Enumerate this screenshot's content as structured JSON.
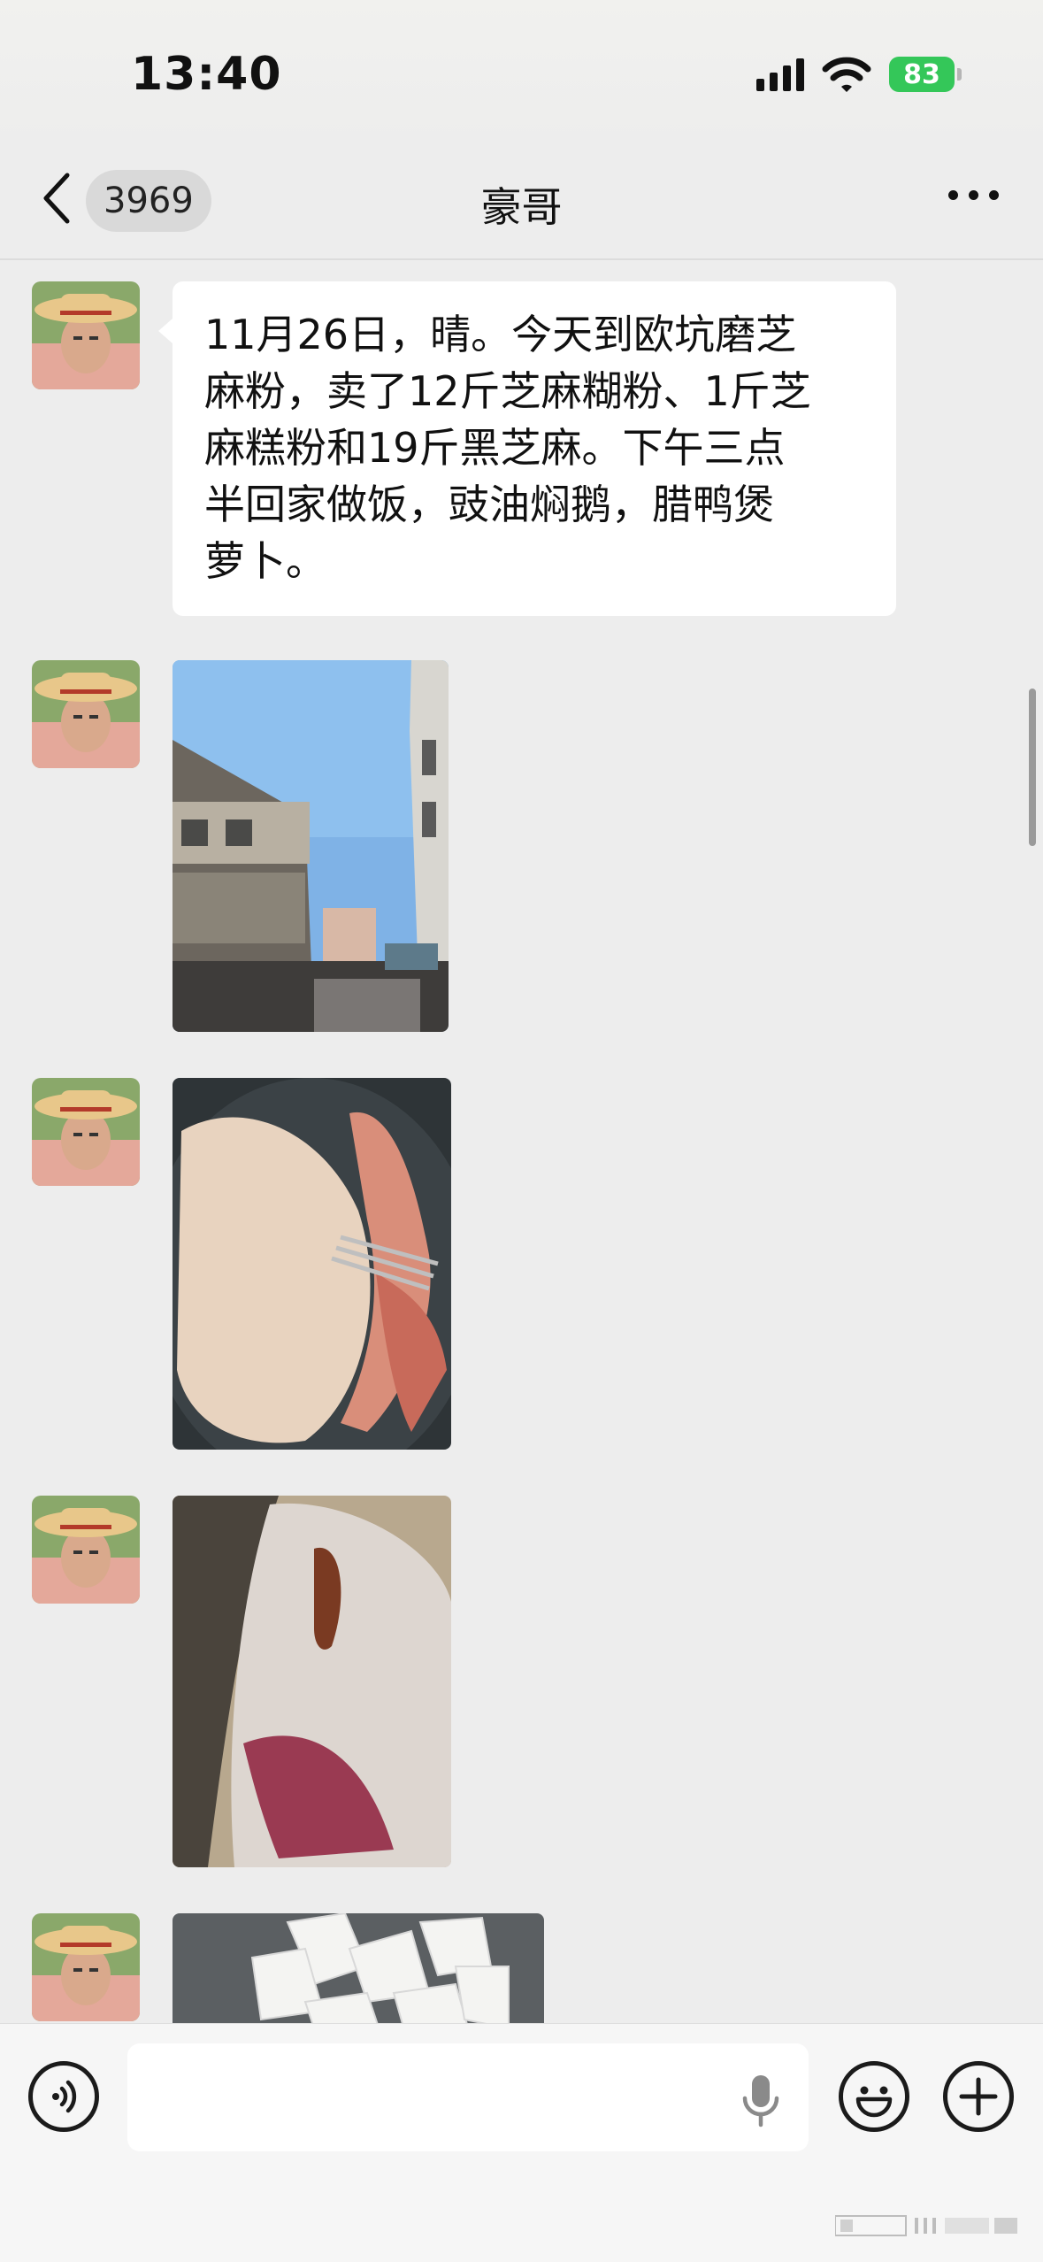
{
  "status_bar": {
    "time": "13:40",
    "battery": "83",
    "icons": [
      "signal-icon",
      "wifi-icon",
      "battery-icon"
    ]
  },
  "nav": {
    "back_icon": "chevron-left-icon",
    "unread_count": "3969",
    "title": "豪哥",
    "more_icon": "more-horizontal-icon"
  },
  "messages": [
    {
      "type": "text",
      "sender": "豪哥",
      "lines": [
        "11月26日，晴。今天到欧坑磨芝",
        "麻粉，卖了12斤芝麻糊粉、1斤芝",
        "麻糕粉和19斤黑芝麻。下午三点",
        "半回家做饭，豉油焖鹅，腊鸭煲",
        "萝卜。"
      ]
    },
    {
      "type": "image",
      "sender": "豪哥"
    },
    {
      "type": "image",
      "sender": "豪哥"
    },
    {
      "type": "image",
      "sender": "豪哥"
    },
    {
      "type": "image",
      "sender": "豪哥"
    }
  ],
  "input_bar": {
    "voice_icon": "voice-icon",
    "input_value": "",
    "mic_icon": "microphone-icon",
    "emoji_icon": "emoji-icon",
    "plus_icon": "plus-icon"
  },
  "colors": {
    "background": "#ededed",
    "bubble": "#ffffff",
    "battery": "#34c759"
  }
}
